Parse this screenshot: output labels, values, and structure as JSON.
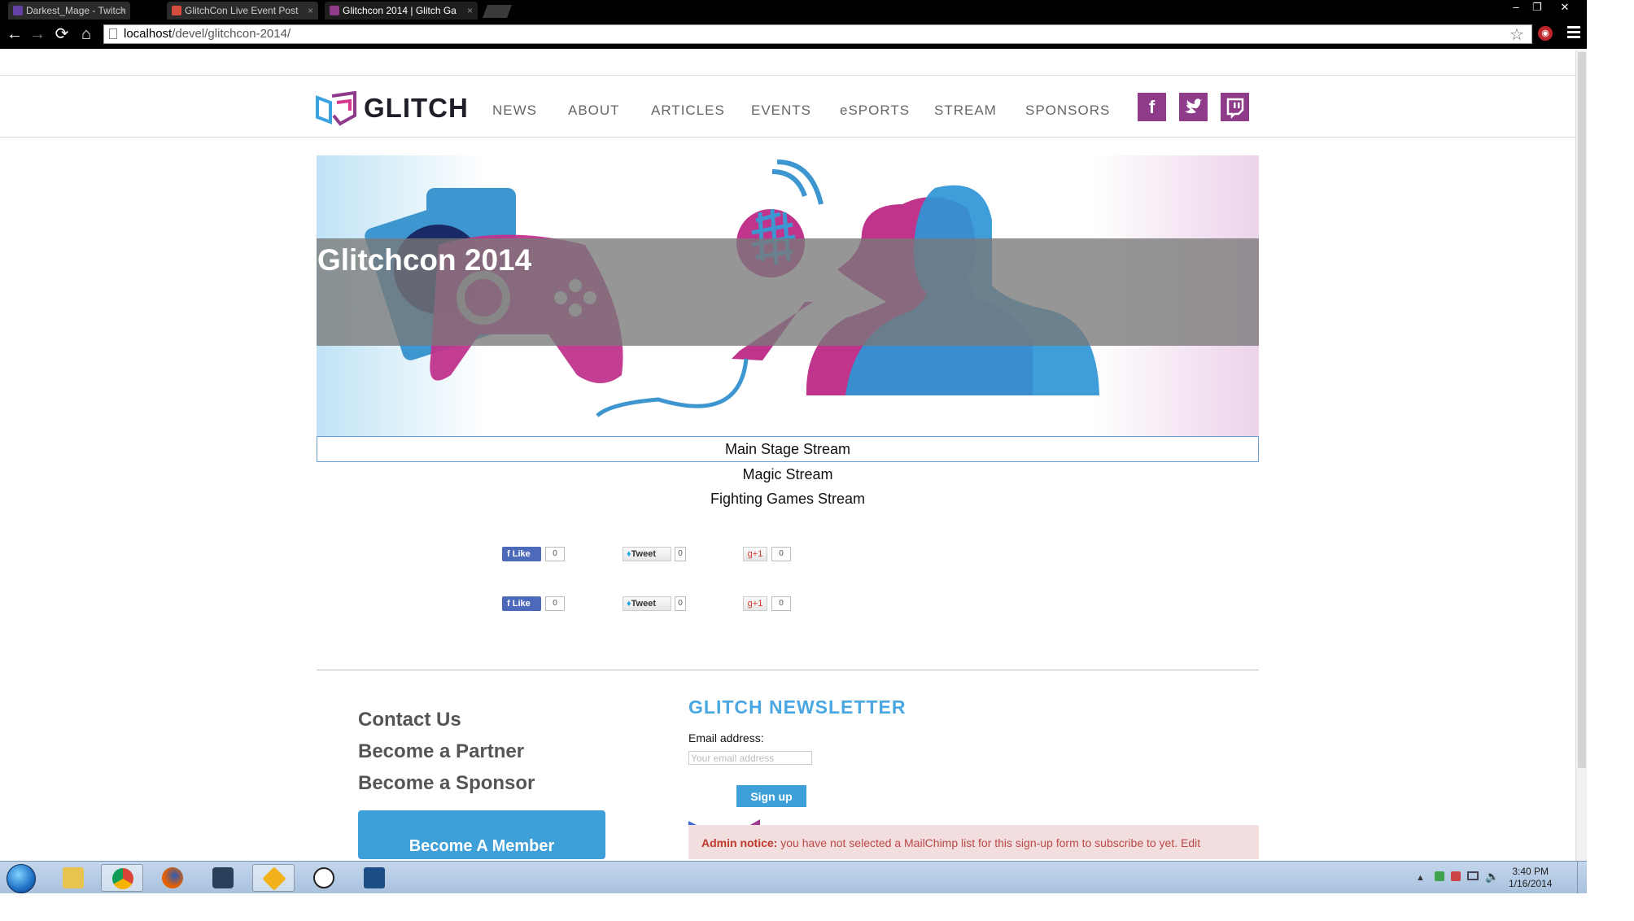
{
  "browser": {
    "tabs": [
      {
        "title": "Darkest_Mage - Twitch",
        "favicon_color": "#6441a5"
      },
      {
        "title": "GlitchCon Live Event Post",
        "favicon_color": "#d54b3d"
      },
      {
        "title": "Glitchcon 2014 | Glitch Ga",
        "favicon_color": "#8e3c8a"
      }
    ],
    "url_host": "localhost",
    "url_path": "/devel/glitchcon-2014/",
    "window_buttons": {
      "minimize": "–",
      "restore": "❐",
      "close": "✕"
    },
    "nav": {
      "back": "←",
      "forward": "→",
      "reload": "⟳",
      "home": "⌂"
    },
    "bookmark_icon": "☆",
    "extension_badge": "◉"
  },
  "site": {
    "brand": "GLITCH",
    "nav": [
      "NEWS",
      "ABOUT",
      "ARTICLES",
      "EVENTS",
      "eSPORTS",
      "STREAM",
      "SPONSORS"
    ],
    "social": [
      {
        "name": "facebook-icon",
        "glyph": "f"
      },
      {
        "name": "twitter-icon",
        "glyph": "🐦"
      },
      {
        "name": "twitch-icon",
        "glyph": "▢"
      }
    ],
    "brand_color": "#8e3c8a"
  },
  "hero": {
    "title": "Glitchcon 2014"
  },
  "streams": [
    "Main Stage Stream",
    "Magic Stream",
    "Fighting Games Stream"
  ],
  "share": {
    "like_label": "Like",
    "tweet_label": "Tweet",
    "gplus_label": "g+1",
    "rows": [
      {
        "likes": "0",
        "tweets": "0",
        "plus": "0"
      },
      {
        "likes": "0",
        "tweets": "0",
        "plus": "0"
      }
    ]
  },
  "footer": {
    "links": [
      "Contact Us",
      "Become a Partner",
      "Become a Sponsor"
    ],
    "member_button": "Become A Member",
    "newsletter_title": "GLITCH NEWSLETTER",
    "email_label": "Email address:",
    "email_placeholder": "Your email address",
    "signup_label": "Sign up",
    "admin_notice_prefix": "Admin notice:",
    "admin_notice_text": " you have not selected a MailChimp list for this sign-up form to subscribe to yet. Edit"
  },
  "taskbar": {
    "time": "3:40 PM",
    "date": "1/16/2014",
    "tray_up_arrow": "▲",
    "apps": [
      {
        "name": "explorer-icon",
        "color": "#e8c34f"
      },
      {
        "name": "chrome-icon",
        "color": "#db4437"
      },
      {
        "name": "firefox-icon",
        "color": "#e66000"
      },
      {
        "name": "steam-icon",
        "color": "#2a3f5a"
      },
      {
        "name": "xsplit-icon",
        "color": "#f1b21c"
      },
      {
        "name": "lol-launcher-icon",
        "color": "#ffffff"
      },
      {
        "name": "starcraft-icon",
        "color": "#1c4e86"
      }
    ]
  }
}
